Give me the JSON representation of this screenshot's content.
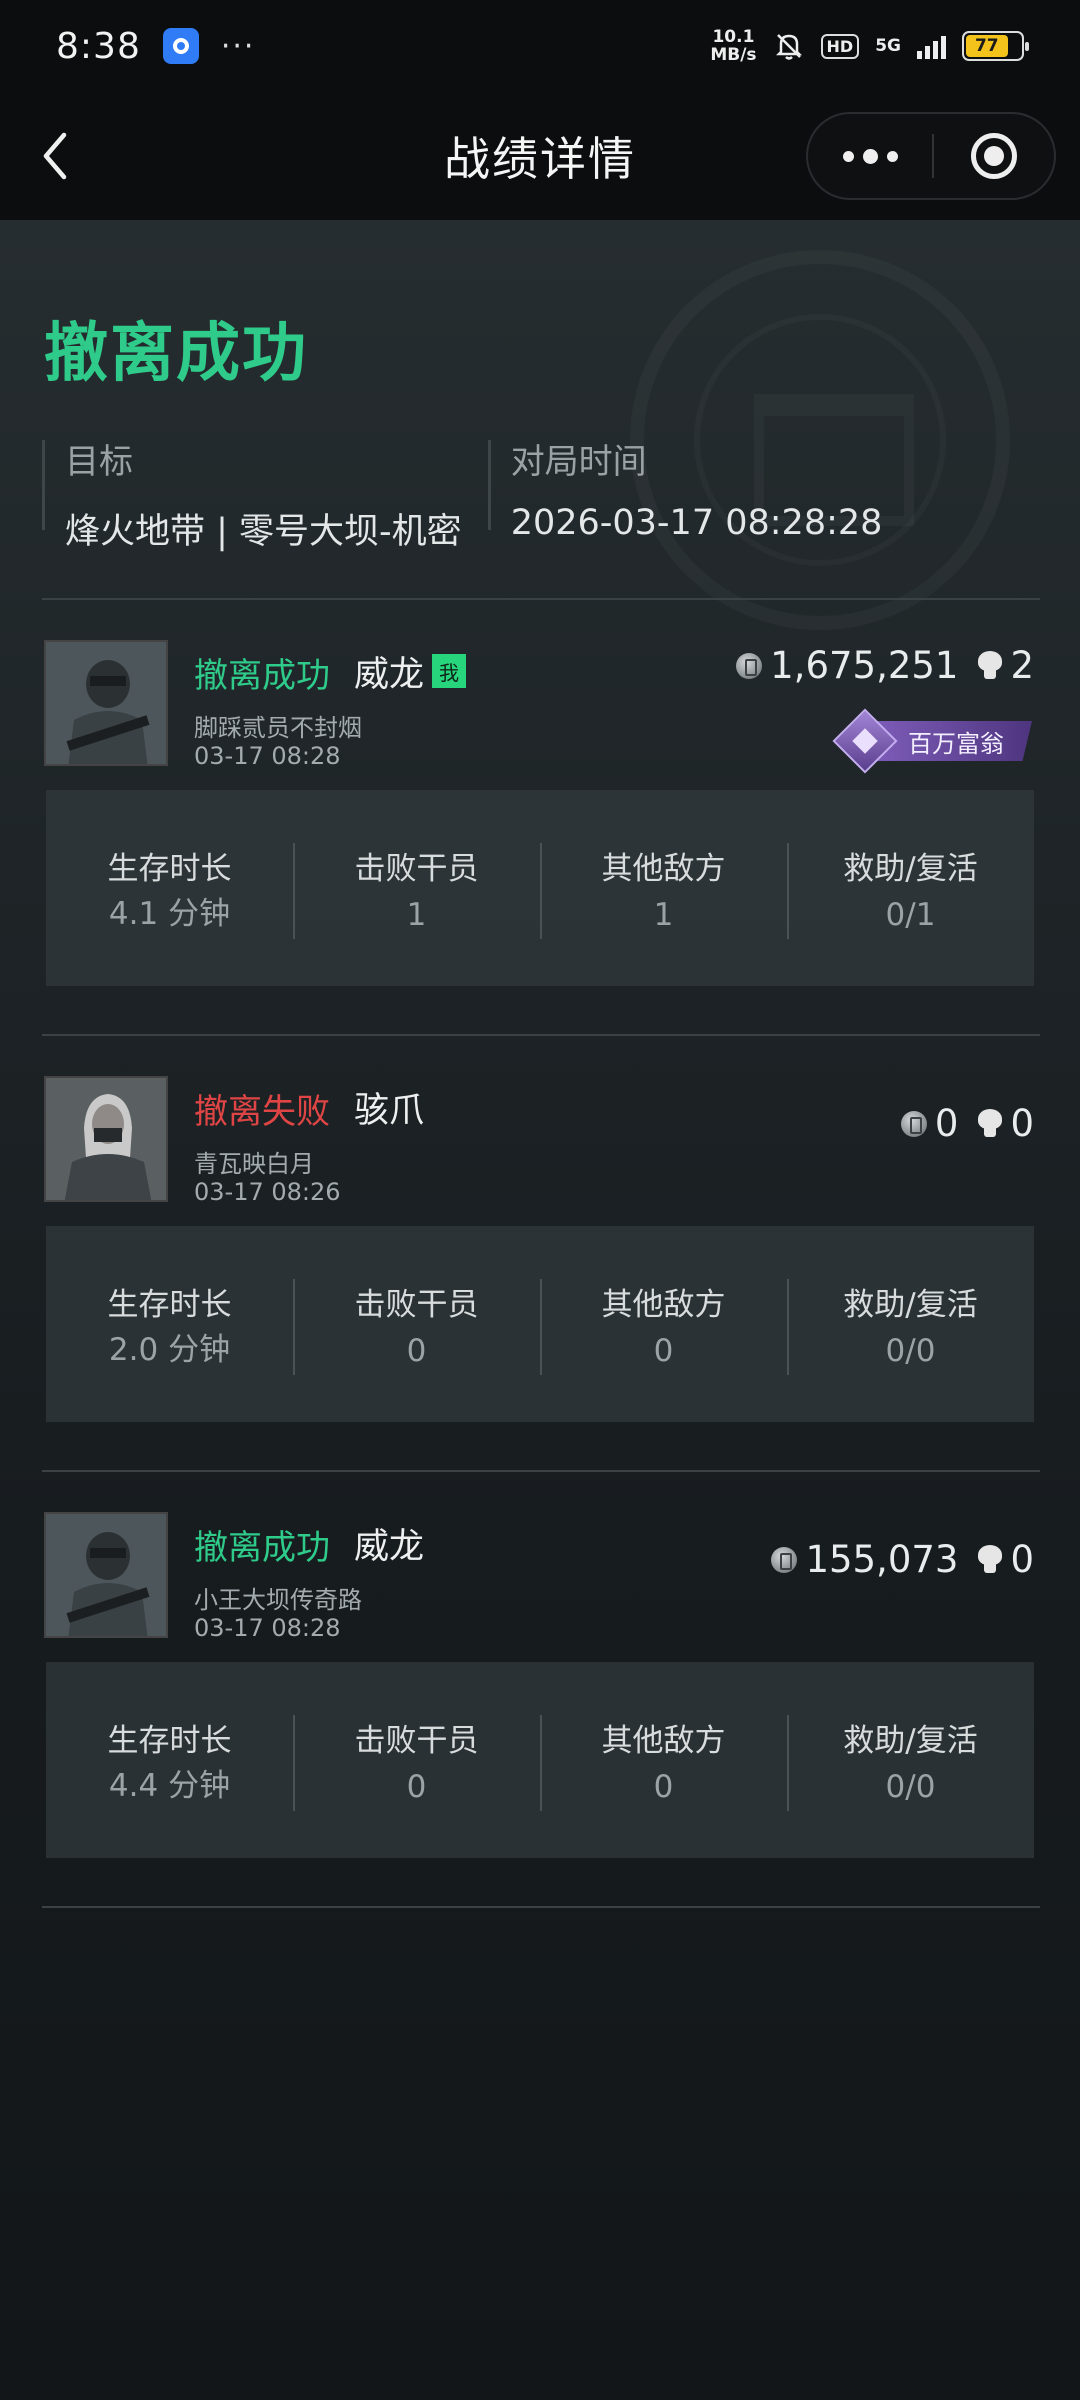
{
  "status_bar": {
    "time": "8:38",
    "dots": "···",
    "net_speed_value": "10.1",
    "net_speed_unit": "MB/s",
    "hd": "HD",
    "network": "5G",
    "battery": "77"
  },
  "nav": {
    "title": "战绩详情"
  },
  "summary": {
    "result": "撤离成功",
    "target_label": "目标",
    "target_value": "烽火地带 | 零号大坝-机密",
    "time_label": "对局时间",
    "time_value": "2026-03-17 08:28:28"
  },
  "stat_labels": {
    "survival": "生存时长",
    "kills": "击败干员",
    "others": "其他敌方",
    "rescue": "救助/复活"
  },
  "players": [
    {
      "status": "撤离成功",
      "status_type": "success",
      "operator": "威龙",
      "me_badge": "我",
      "nickname": "脚踩贰员不封烟",
      "time": "03-17 08:28",
      "value": "1,675,251",
      "kills_count": "2",
      "badge": "百万富翁",
      "survival": "4.1 分钟",
      "kills": "1",
      "others": "1",
      "rescue": "0/1"
    },
    {
      "status": "撤离失败",
      "status_type": "fail",
      "operator": "骇爪",
      "nickname": "青瓦映白月",
      "time": "03-17 08:26",
      "value": "0",
      "kills_count": "0",
      "survival": "2.0 分钟",
      "kills": "0",
      "others": "0",
      "rescue": "0/0"
    },
    {
      "status": "撤离成功",
      "status_type": "success",
      "operator": "威龙",
      "nickname": "小王大坝传奇路",
      "time": "03-17 08:28",
      "value": "155,073",
      "kills_count": "0",
      "survival": "4.4 分钟",
      "kills": "0",
      "others": "0",
      "rescue": "0/0"
    }
  ],
  "colors": {
    "success": "#2ecb8a",
    "fail": "#e04545",
    "me_badge": "#27d67c",
    "rich_badge": "#7d5cb8"
  },
  "icons": {
    "coin": "coin-icon",
    "skull": "skull-icon",
    "back": "chevron-left-icon",
    "more": "more-dots-icon",
    "close": "target-circle-icon"
  }
}
